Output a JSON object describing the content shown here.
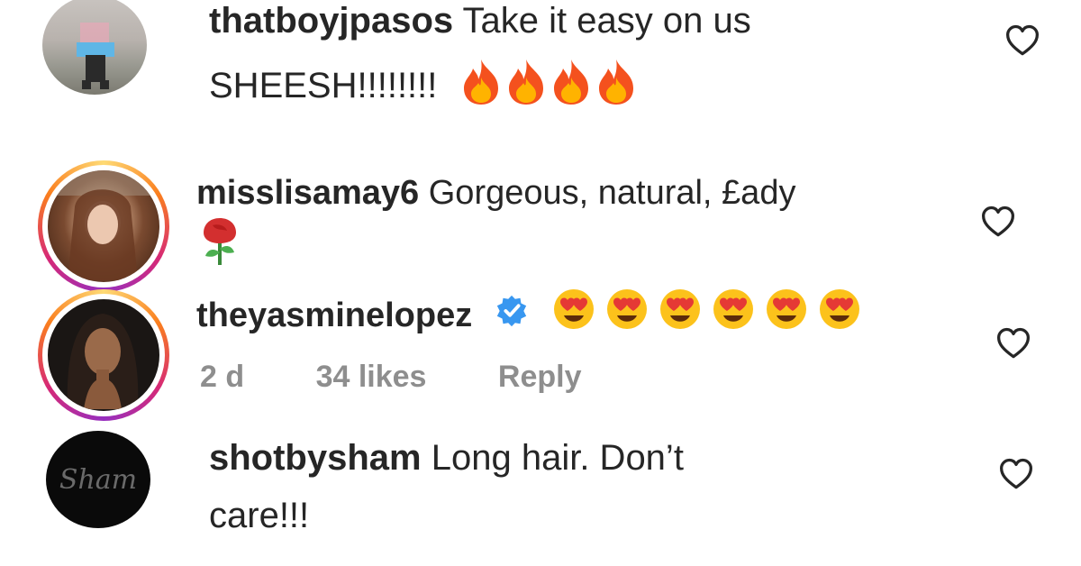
{
  "comments": [
    {
      "username": "thatboyjpasos",
      "text_line1": "Take it easy on us",
      "text_line2": "SHEESH!!!!!!!!",
      "emoji": "fire x4"
    },
    {
      "username": "misslisamay6",
      "text_line1": "Gorgeous, natural, £ady",
      "emoji": "rose"
    },
    {
      "username": "theyasminelopez",
      "verified": true,
      "emoji": "heart-eyes x6",
      "time": "2 d",
      "likes": "34 likes",
      "reply": "Reply"
    },
    {
      "username": "shotbysham",
      "text_line1": "Long hair. Don’t",
      "text_line2": "care!!!"
    }
  ],
  "colors": {
    "text": "#262626",
    "meta": "#8e8e8e",
    "verified": "#3897f0"
  },
  "icons": [
    "heart-outline-icon",
    "verified-badge-icon",
    "fire-emoji",
    "heart-eyes-emoji",
    "rose-emoji"
  ]
}
